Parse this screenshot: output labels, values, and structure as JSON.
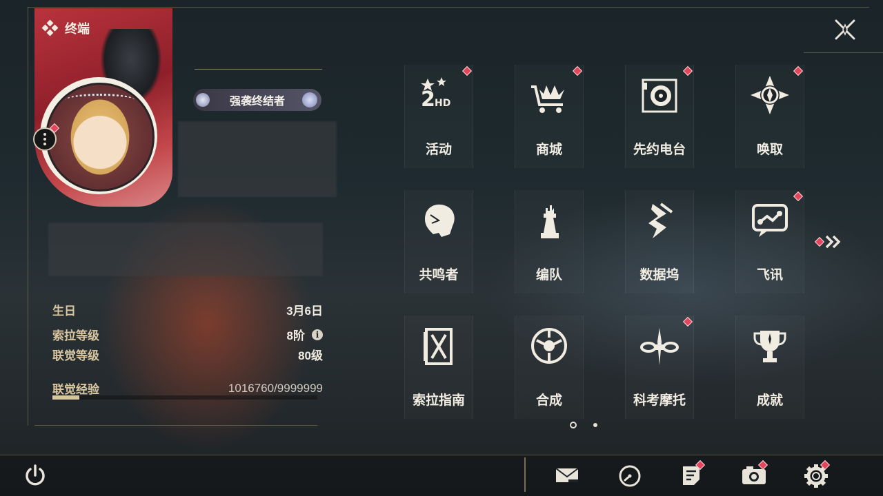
{
  "header": {
    "title": "终端"
  },
  "profile": {
    "title_badge": "强袭终结者"
  },
  "stats": [
    {
      "label": "生日",
      "value": "3月6日"
    },
    {
      "label": "索拉等级",
      "value": "8阶"
    },
    {
      "label": "联觉等级",
      "value": "80级"
    },
    {
      "label": "联觉经验",
      "value": "1016760/9999999",
      "progress": 0.102
    }
  ],
  "menu": [
    {
      "label": "活动",
      "icon": "events-2hd-icon",
      "badge": true
    },
    {
      "label": "商城",
      "icon": "shop-cart-icon",
      "badge": true
    },
    {
      "label": "先约电台",
      "icon": "radio-icon",
      "badge": true
    },
    {
      "label": "唤取",
      "icon": "gacha-compass-icon",
      "badge": true
    },
    {
      "label": "共鸣者",
      "icon": "resonator-head-icon",
      "badge": false
    },
    {
      "label": "编队",
      "icon": "team-chess-icon",
      "badge": false
    },
    {
      "label": "数据坞",
      "icon": "databank-icon",
      "badge": false
    },
    {
      "label": "飞讯",
      "icon": "chat-bubble-icon",
      "badge": true
    },
    {
      "label": "索拉指南",
      "icon": "guidebook-icon",
      "badge": false
    },
    {
      "label": "合成",
      "icon": "synthesis-icon",
      "badge": false
    },
    {
      "label": "科考摩托",
      "icon": "motorbike-icon",
      "badge": true
    },
    {
      "label": "成就",
      "icon": "trophy-icon",
      "badge": false
    }
  ],
  "pager": {
    "pages": 2,
    "current": 1
  },
  "bottom": [
    "power-icon",
    "mail-icon",
    "clock-icon",
    "notice-icon",
    "camera-icon",
    "settings-gear-icon"
  ],
  "colors": {
    "badge": "#e5455a",
    "accent_gold": "#d8c6a0",
    "text": "#f2ede3"
  }
}
